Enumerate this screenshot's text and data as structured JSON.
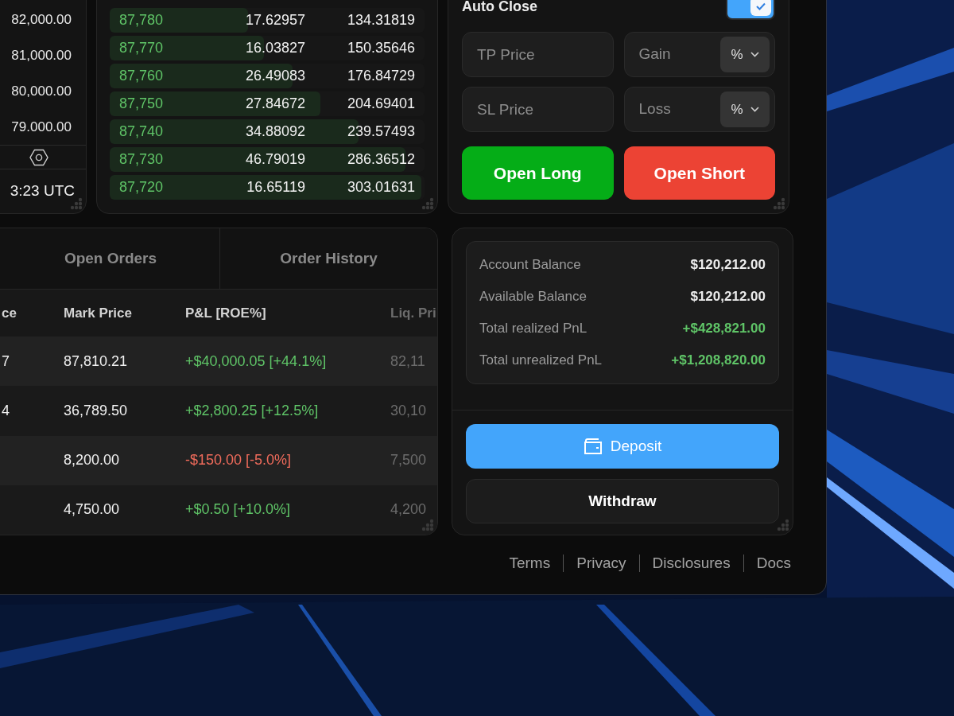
{
  "chart": {
    "price_labels": [
      "82,000.00",
      "81,000.00",
      "80,000.00",
      "79.000.00"
    ],
    "time_label": "3:23 UTC"
  },
  "order_book": {
    "rows": [
      {
        "price": "87,780",
        "amount": "17.62957",
        "total": "134.31819",
        "level": 0.44
      },
      {
        "price": "87,770",
        "amount": "16.03827",
        "total": "150.35646",
        "level": 0.49
      },
      {
        "price": "87,760",
        "amount": "26.49083",
        "total": "176.84729",
        "level": 0.58
      },
      {
        "price": "87,750",
        "amount": "27.84672",
        "total": "204.69401",
        "level": 0.67
      },
      {
        "price": "87,740",
        "amount": "34.88092",
        "total": "239.57493",
        "level": 0.79
      },
      {
        "price": "87,730",
        "amount": "46.79019",
        "total": "286.36512",
        "level": 0.94
      },
      {
        "price": "87,720",
        "amount": "16.65119",
        "total": "303.01631",
        "level": 0.99
      }
    ]
  },
  "order_form": {
    "auto_close": {
      "label": "Auto Close",
      "checked": true
    },
    "fields": [
      {
        "kind": "price",
        "placeholder": "TP Price"
      },
      {
        "kind": "percent",
        "placeholder": "Gain",
        "unit": "%"
      },
      {
        "kind": "price",
        "placeholder": "SL Price"
      },
      {
        "kind": "percent",
        "placeholder": "Loss",
        "unit": "%"
      }
    ],
    "buttons": [
      {
        "kind": "long",
        "label": "Open Long"
      },
      {
        "kind": "short",
        "label": "Open Short"
      }
    ]
  },
  "positions": {
    "tabs": [
      {
        "label": "Open Orders",
        "selected": false
      },
      {
        "label": "Order History",
        "selected": false
      }
    ],
    "columns": [
      "ce",
      "Mark Price",
      "P&L [ROE%]",
      "Liq. Pri"
    ],
    "rows": [
      {
        "column_1": "7",
        "mark_price": "87,810.21",
        "pnl": "+$40,000.05 [+44.1%]",
        "color": "#5fc467",
        "liq_price": "82,11"
      },
      {
        "column_1": "4",
        "mark_price": "36,789.50",
        "pnl": "+$2,800.25 [+12.5%]",
        "color": "#5fc467",
        "liq_price": "30,10"
      },
      {
        "mark_price": "8,200.00",
        "pnl": "-$150.00 [-5.0%]",
        "color": "#ef6b5b",
        "liq_price": "7,500"
      },
      {
        "mark_price": "4,750.00",
        "pnl": "+$0.50 [+10.0%]",
        "color": "#5fc467",
        "liq_price": "4,200"
      }
    ]
  },
  "account": {
    "rows": [
      {
        "label": "Account Balance",
        "value": "$120,212.00",
        "color": "#ececec"
      },
      {
        "label": "Available Balance",
        "value": "$120,212.00",
        "color": "#ececec"
      },
      {
        "label": "Total realized PnL",
        "value": "+$428,821.00",
        "color": "#5fc467"
      },
      {
        "label": "Total unrealized PnL",
        "value": "+$1,208,820.00",
        "color": "#5fc467"
      }
    ],
    "buttons": [
      {
        "kind": "primary",
        "label": "Deposit"
      },
      {
        "kind": "secondary",
        "label": "Withdraw"
      }
    ]
  },
  "footer_links": [
    "Terms",
    "Privacy",
    "Disclosures",
    "Docs"
  ]
}
